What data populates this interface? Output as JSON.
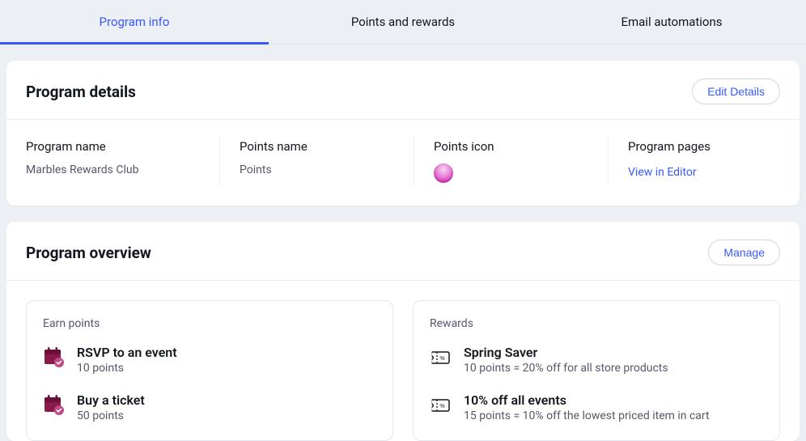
{
  "tabs": {
    "program_info": "Program info",
    "points_rewards": "Points and rewards",
    "email_automations": "Email automations"
  },
  "details_card": {
    "title": "Program details",
    "edit_button": "Edit Details",
    "program_name_label": "Program name",
    "program_name_value": "Marbles Rewards Club",
    "points_name_label": "Points name",
    "points_name_value": "Points",
    "points_icon_label": "Points icon",
    "program_pages_label": "Program pages",
    "view_in_editor": "View in Editor"
  },
  "overview_card": {
    "title": "Program overview",
    "manage_button": "Manage",
    "earn": {
      "title": "Earn points",
      "items": [
        {
          "title": "RSVP to an event",
          "sub": "10 points"
        },
        {
          "title": "Buy a ticket",
          "sub": "50 points"
        }
      ]
    },
    "rewards": {
      "title": "Rewards",
      "items": [
        {
          "title": "Spring Saver",
          "sub": "10 points = 20% off for all store products"
        },
        {
          "title": "10% off all events",
          "sub": "15 points = 10% off the lowest priced item in cart"
        }
      ]
    }
  }
}
